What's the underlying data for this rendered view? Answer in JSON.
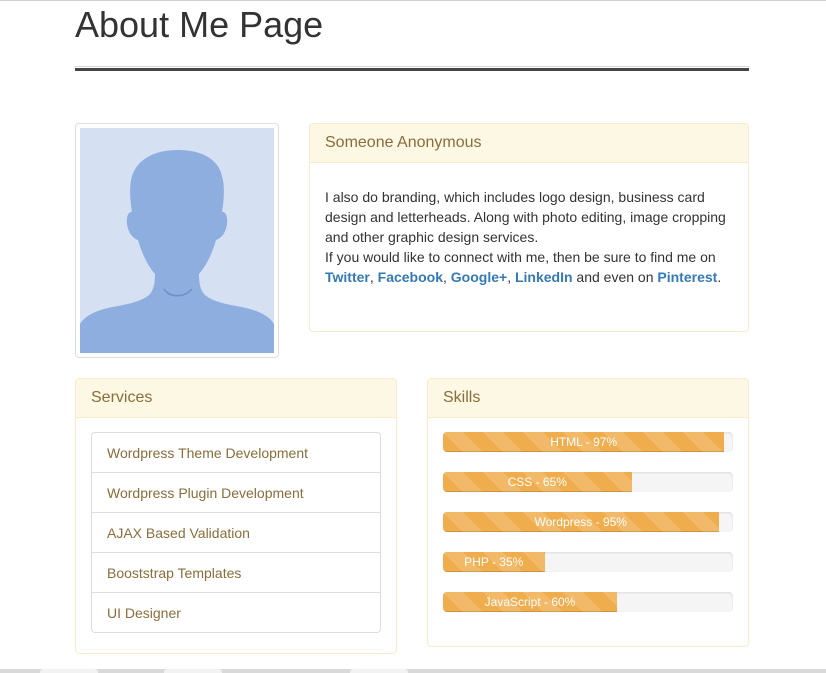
{
  "page": {
    "title": "About Me Page"
  },
  "profile": {
    "name": "Someone Anonymous",
    "bio_line1": "I also do branding, which includes logo design, business card design and letterheads. Along with photo editing, image cropping and other graphic design services.",
    "bio_line2_prefix": "If you would like to connect with me, then be sure to find me on",
    "links": {
      "twitter": "Twitter",
      "facebook": "Facebook",
      "googleplus": "Google+",
      "linkedin": "LinkedIn",
      "pinterest": "Pinterest"
    },
    "sep1": ", ",
    "sep2": ", ",
    "sep3": ", ",
    "and_even_on": " and even on",
    "end": "."
  },
  "services": {
    "heading": "Services",
    "items": [
      "Wordpress Theme Development",
      "Wordpress Plugin Development",
      "AJAX Based Validation",
      "Booststrap Templates",
      "UI Designer"
    ]
  },
  "skills": {
    "heading": "Skills",
    "items": [
      {
        "label": "HTML - 97%",
        "percent": 97
      },
      {
        "label": "CSS - 65%",
        "percent": 65
      },
      {
        "label": "Wordpress - 95%",
        "percent": 95
      },
      {
        "label": "PHP - 35%",
        "percent": 35
      },
      {
        "label": "JavaScript - 60%",
        "percent": 60
      }
    ]
  },
  "colors": {
    "panel_heading_bg": "#fcf8e3",
    "panel_heading_text": "#8a6d3b",
    "panel_border": "#faebcc",
    "link": "#337ab7",
    "progress_bar": "#f0ad4e",
    "avatar_bg": "#d5e0f3",
    "avatar_figure": "#8eaee0"
  }
}
